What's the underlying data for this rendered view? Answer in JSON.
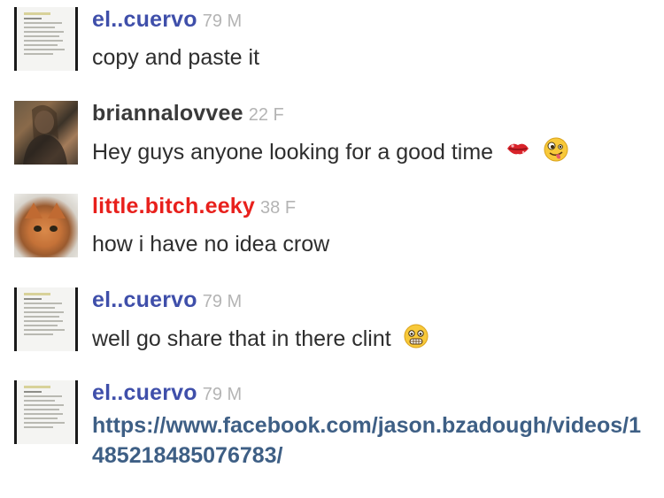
{
  "messages": [
    {
      "username": "el..cuervo",
      "meta": "79 M",
      "text": "copy and paste it",
      "username_color": "#3f4faa",
      "avatar": "document-thumbnail"
    },
    {
      "username": "briannalovvee",
      "meta": "22 F",
      "text": "Hey guys anyone looking for a good time",
      "username_color": "#3a3a3a",
      "avatar": "person-photo",
      "emojis": [
        "kiss-lips-icon",
        "zany-face-icon"
      ]
    },
    {
      "username": "little.bitch.eeky",
      "meta": "38 F",
      "text": "how i have no idea crow",
      "username_color": "#e8201c",
      "avatar": "kitten-photo"
    },
    {
      "username": "el..cuervo",
      "meta": "79 M",
      "text": "well go share that in there clint",
      "username_color": "#3f4faa",
      "avatar": "document-thumbnail",
      "emojis": [
        "grimacing-face-icon"
      ]
    },
    {
      "username": "el..cuervo",
      "meta": "79 M",
      "link": "https://www.facebook.com/jason.bzadough/videos/1485218485076783/",
      "username_color": "#3f4faa",
      "avatar": "document-thumbnail"
    }
  ]
}
